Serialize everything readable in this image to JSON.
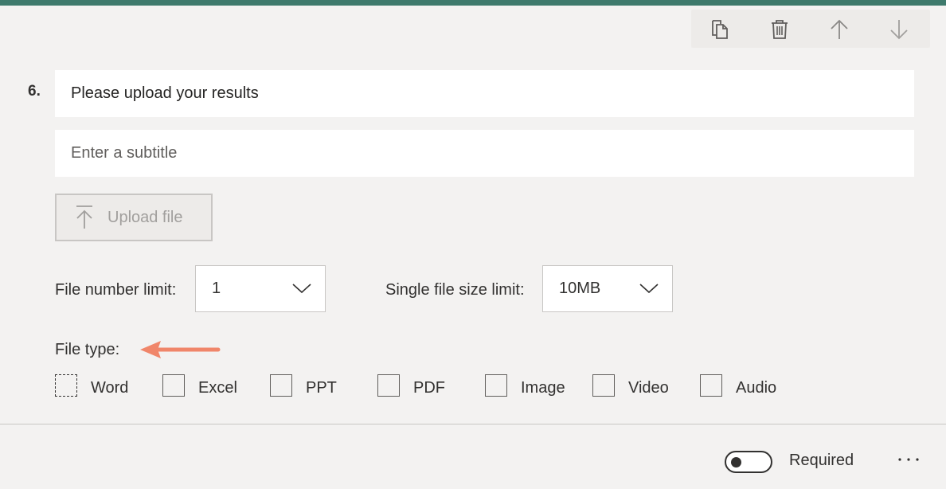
{
  "toolbar": {
    "icons": [
      "copy-icon",
      "delete-icon",
      "move-up-icon",
      "move-down-icon"
    ]
  },
  "question": {
    "number": "6.",
    "title": "Please upload your results",
    "subtitle_placeholder": "Enter a subtitle"
  },
  "upload": {
    "label": "Upload file",
    "icon": "upload-arrow-icon"
  },
  "limits": {
    "file_number_label": "File number limit:",
    "file_number_value": "1",
    "file_size_label": "Single file size limit:",
    "file_size_value": "10MB"
  },
  "file_type": {
    "label": "File type:",
    "options": [
      {
        "label": "Word",
        "checked": false
      },
      {
        "label": "Excel",
        "checked": false
      },
      {
        "label": "PPT",
        "checked": false
      },
      {
        "label": "PDF",
        "checked": false
      },
      {
        "label": "Image",
        "checked": false
      },
      {
        "label": "Video",
        "checked": false
      },
      {
        "label": "Audio",
        "checked": false
      }
    ]
  },
  "footer": {
    "required_label": "Required",
    "required_on": false
  },
  "colors": {
    "accent_bar": "#3e7a6c",
    "annotation_arrow": "#f0866a",
    "background": "#f3f2f1"
  }
}
